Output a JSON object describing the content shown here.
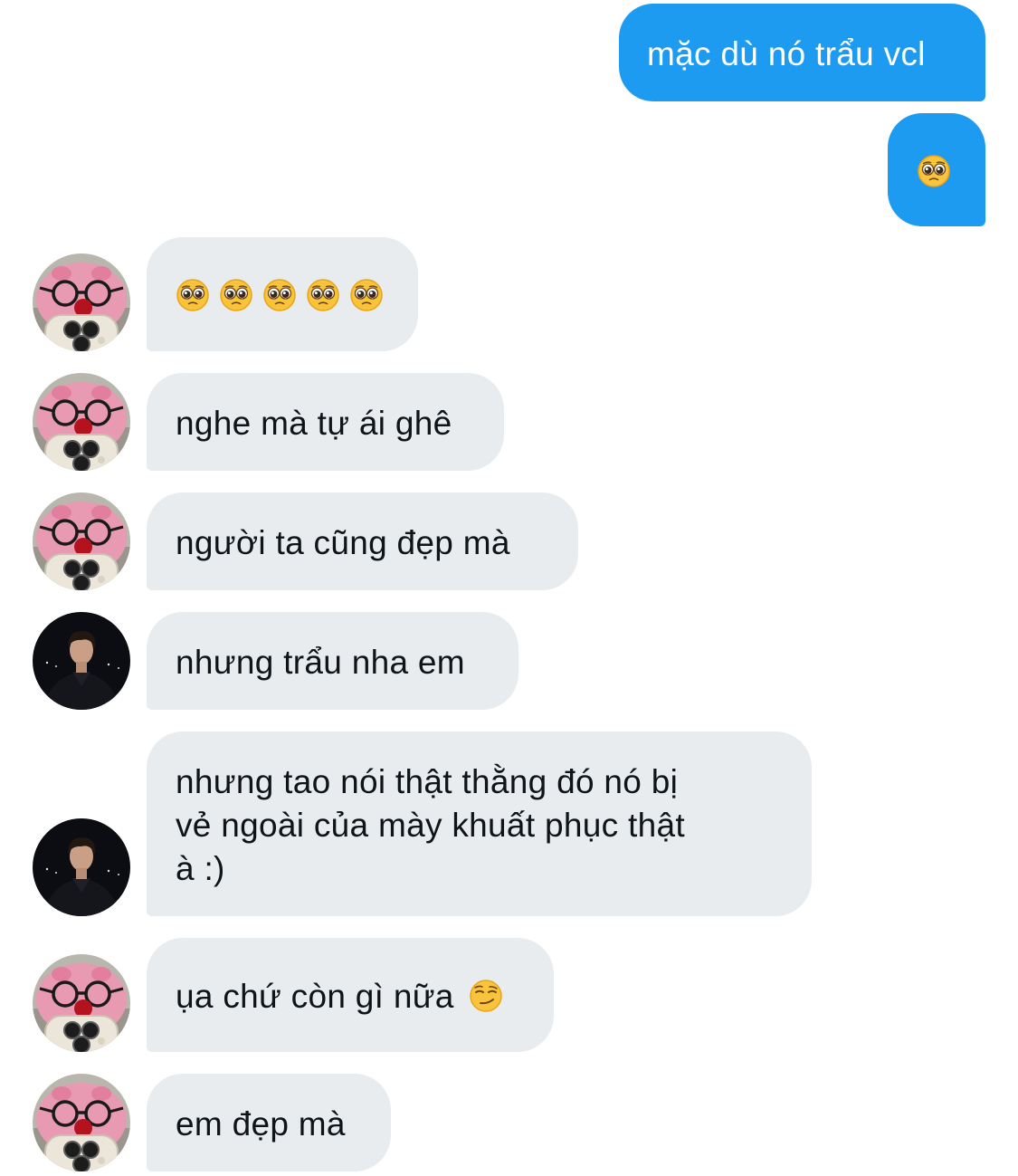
{
  "messages": {
    "m1": {
      "text": "mặc dù nó trẩu vcl",
      "side": "sent"
    },
    "m2": {
      "emoji": "pleading-face",
      "side": "sent"
    },
    "m3": {
      "emoji_count": 5,
      "emoji": "pleading-face",
      "side": "received",
      "sender": "pink-plush"
    },
    "m4": {
      "text": "nghe mà tự ái ghê",
      "side": "received",
      "sender": "pink-plush"
    },
    "m5": {
      "text": "người ta cũng đẹp mà",
      "side": "received",
      "sender": "pink-plush"
    },
    "m6": {
      "text": "nhưng trẩu nha em",
      "side": "received",
      "sender": "dark-portrait"
    },
    "m7": {
      "lines": [
        "nhưng tao nói thật thằng đó nó bị",
        "vẻ ngoài của mày khuất phục thật",
        "à :)"
      ],
      "side": "received",
      "sender": "dark-portrait"
    },
    "m8": {
      "text": "ụa chứ còn gì nữa",
      "emoji": "smirking-face",
      "side": "received",
      "sender": "pink-plush"
    },
    "m9": {
      "text": "em đẹp mà",
      "side": "received",
      "sender": "pink-plush"
    }
  },
  "colors": {
    "sent_bubble": "#1d9bf0",
    "received_bubble": "#e8ecef",
    "sent_text": "#ffffff",
    "received_text": "#0f1419"
  }
}
